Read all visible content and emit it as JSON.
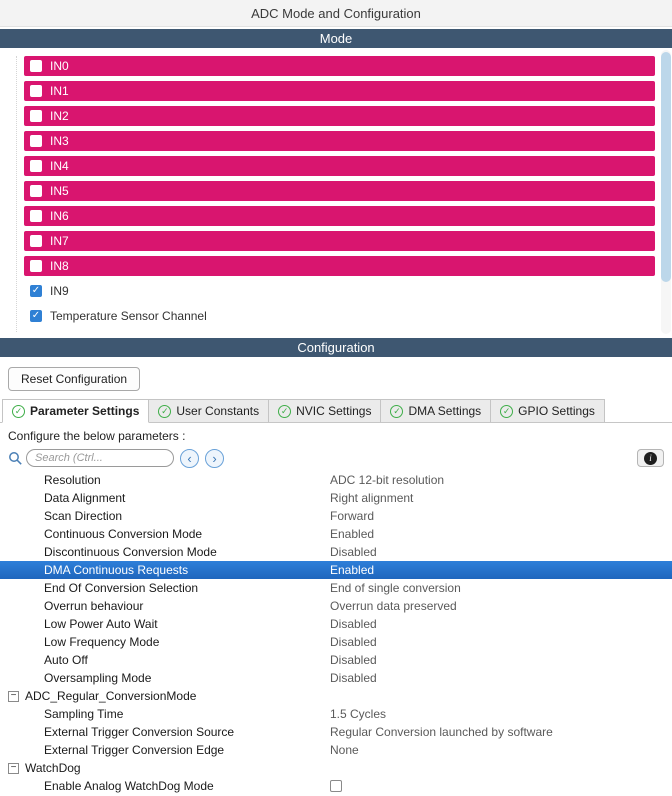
{
  "colors": {
    "header_bg": "#3e5771",
    "channel_pink": "#d9156f",
    "check_blue": "#2f80d4",
    "selected_row_top": "#2e7fd9",
    "selected_row_bottom": "#1f66bd",
    "tab_check_green": "#3fae49"
  },
  "icons": {
    "check": "✓",
    "chevron_left": "‹",
    "chevron_right": "›",
    "info": "i",
    "collapse_minus": "−"
  },
  "window": {
    "title": "ADC Mode and Configuration"
  },
  "mode": {
    "header": "Mode",
    "channels": [
      {
        "label": "IN0",
        "checked": false,
        "pink": true
      },
      {
        "label": "IN1",
        "checked": false,
        "pink": true
      },
      {
        "label": "IN2",
        "checked": false,
        "pink": true
      },
      {
        "label": "IN3",
        "checked": false,
        "pink": true
      },
      {
        "label": "IN4",
        "checked": false,
        "pink": true
      },
      {
        "label": "IN5",
        "checked": false,
        "pink": true
      },
      {
        "label": "IN6",
        "checked": false,
        "pink": true
      },
      {
        "label": "IN7",
        "checked": false,
        "pink": true
      },
      {
        "label": "IN8",
        "checked": false,
        "pink": true
      },
      {
        "label": "IN9",
        "checked": true,
        "pink": false
      },
      {
        "label": "Temperature Sensor Channel",
        "checked": true,
        "pink": false
      }
    ]
  },
  "configuration": {
    "header": "Configuration",
    "reset_button_label": "Reset Configuration",
    "tabs": [
      {
        "label": "Parameter Settings",
        "active": true
      },
      {
        "label": "User Constants",
        "active": false
      },
      {
        "label": "NVIC Settings",
        "active": false
      },
      {
        "label": "DMA Settings",
        "active": false
      },
      {
        "label": "GPIO Settings",
        "active": false
      }
    ],
    "configure_label": "Configure the below parameters :",
    "search": {
      "placeholder": "Search (Ctrl...",
      "value": ""
    },
    "parameters": [
      {
        "type": "param",
        "name": "Resolution",
        "value": "ADC 12-bit resolution"
      },
      {
        "type": "param",
        "name": "Data Alignment",
        "value": "Right alignment"
      },
      {
        "type": "param",
        "name": "Scan Direction",
        "value": "Forward"
      },
      {
        "type": "param",
        "name": "Continuous Conversion Mode",
        "value": "Enabled"
      },
      {
        "type": "param",
        "name": "Discontinuous Conversion Mode",
        "value": "Disabled"
      },
      {
        "type": "param",
        "name": "DMA Continuous Requests",
        "value": "Enabled",
        "selected": true
      },
      {
        "type": "param",
        "name": "End Of Conversion Selection",
        "value": "End of single conversion"
      },
      {
        "type": "param",
        "name": "Overrun behaviour",
        "value": "Overrun data preserved"
      },
      {
        "type": "param",
        "name": "Low Power Auto Wait",
        "value": "Disabled"
      },
      {
        "type": "param",
        "name": "Low Frequency Mode",
        "value": "Disabled"
      },
      {
        "type": "param",
        "name": "Auto Off",
        "value": "Disabled"
      },
      {
        "type": "param",
        "name": "Oversampling Mode",
        "value": "Disabled"
      },
      {
        "type": "group",
        "name": "ADC_Regular_ConversionMode"
      },
      {
        "type": "param",
        "name": "Sampling Time",
        "value": "1.5 Cycles"
      },
      {
        "type": "param",
        "name": "External Trigger Conversion Source",
        "value": "Regular Conversion launched by software"
      },
      {
        "type": "param",
        "name": "External Trigger Conversion Edge",
        "value": "None"
      },
      {
        "type": "group",
        "name": "WatchDog"
      },
      {
        "type": "param",
        "name": "Enable Analog WatchDog Mode",
        "value": "",
        "checkbox": true
      }
    ]
  }
}
